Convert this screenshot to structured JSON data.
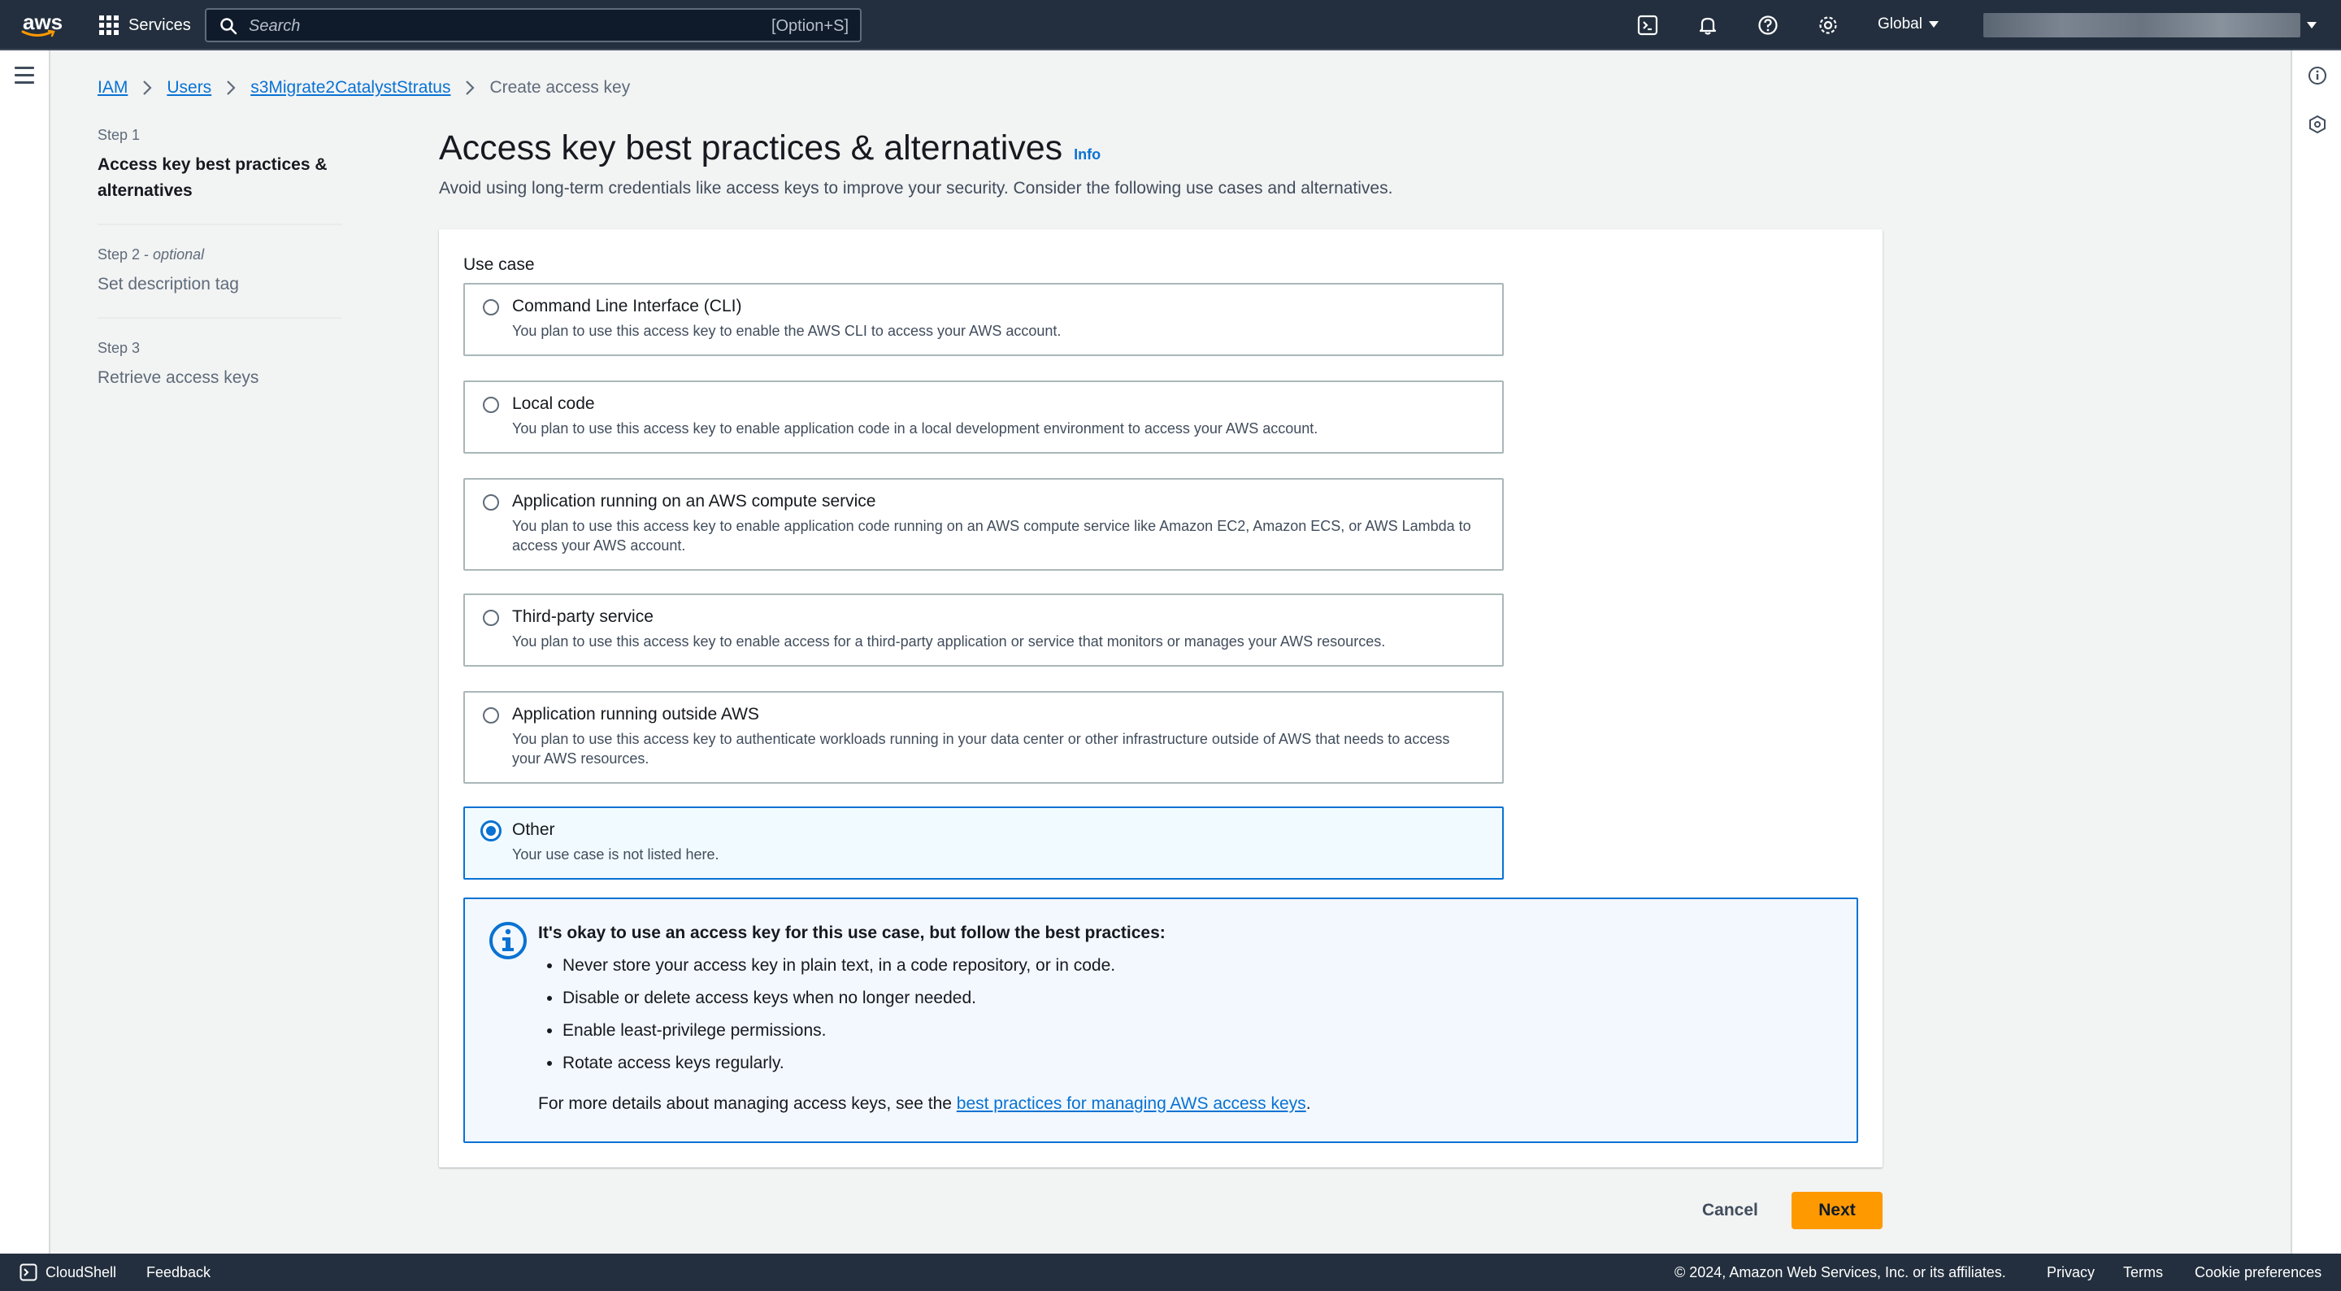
{
  "topnav": {
    "logo_text": "aws",
    "services_label": "Services",
    "search_placeholder": "Search",
    "search_shortcut": "[Option+S]",
    "region_label": "Global",
    "icons": [
      "cloudshell-icon",
      "notifications-bell-icon",
      "help-icon",
      "settings-gear-icon"
    ]
  },
  "breadcrumb": {
    "items": [
      "IAM",
      "Users",
      "s3Migrate2CatalystStratus"
    ],
    "current": "Create access key"
  },
  "steps": [
    {
      "label": "Step 1",
      "optional": "",
      "name": "Access key best practices & alternatives"
    },
    {
      "label": "Step 2",
      "optional": "optional",
      "name": "Set description tag"
    },
    {
      "label": "Step 3",
      "optional": "",
      "name": "Retrieve access keys"
    }
  ],
  "page": {
    "title": "Access key best practices & alternatives",
    "info_link": "Info",
    "description": "Avoid using long-term credentials like access keys to improve your security. Consider the following use cases and alternatives."
  },
  "use_case": {
    "label": "Use case",
    "selected": "Other",
    "options": [
      {
        "title": "Command Line Interface (CLI)",
        "desc": "You plan to use this access key to enable the AWS CLI to access your AWS account."
      },
      {
        "title": "Local code",
        "desc": "You plan to use this access key to enable application code in a local development environment to access your AWS account."
      },
      {
        "title": "Application running on an AWS compute service",
        "desc": "You plan to use this access key to enable application code running on an AWS compute service like Amazon EC2, Amazon ECS, or AWS Lambda to access your AWS account."
      },
      {
        "title": "Third-party service",
        "desc": "You plan to use this access key to enable access for a third-party application or service that monitors or manages your AWS resources."
      },
      {
        "title": "Application running outside AWS",
        "desc": "You plan to use this access key to authenticate workloads running in your data center or other infrastructure outside of AWS that needs to access your AWS resources."
      },
      {
        "title": "Other",
        "desc": "Your use case is not listed here."
      }
    ]
  },
  "alert": {
    "title": "It's okay to use an access key for this use case, but follow the best practices:",
    "bullets": [
      "Never store your access key in plain text, in a code repository, or in code.",
      "Disable or delete access keys when no longer needed.",
      "Enable least-privilege permissions.",
      "Rotate access keys regularly."
    ],
    "more_prefix": "For more details about managing access keys, see the ",
    "more_link": "best practices for managing AWS access keys",
    "more_suffix": "."
  },
  "actions": {
    "cancel": "Cancel",
    "next": "Next"
  },
  "footer": {
    "cloudshell": "CloudShell",
    "feedback": "Feedback",
    "copyright": "© 2024, Amazon Web Services, Inc. or its affiliates.",
    "privacy": "Privacy",
    "terms": "Terms",
    "cookie": "Cookie preferences"
  },
  "colors": {
    "nav_bg": "#232f3e",
    "link": "#0972d3",
    "primary_button": "#ff9900",
    "selected_bg": "#f1faff"
  }
}
